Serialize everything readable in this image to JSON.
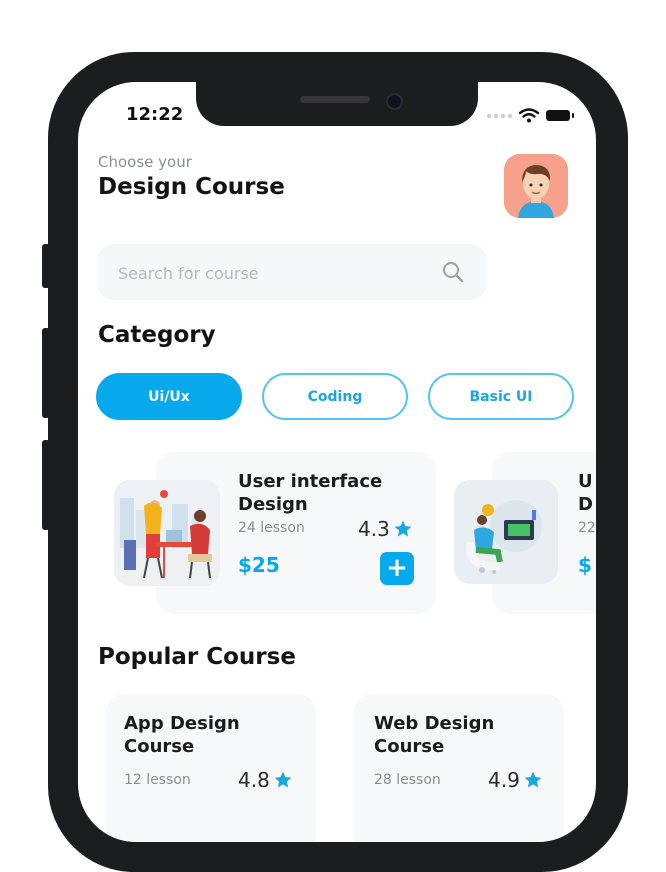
{
  "status_bar": {
    "time": "12:22"
  },
  "header": {
    "subtitle": "Choose your",
    "title": "Design Course"
  },
  "search": {
    "placeholder": "Search for course"
  },
  "category": {
    "heading": "Category",
    "chips": [
      {
        "label": "Ui/Ux",
        "active": true
      },
      {
        "label": "Coding",
        "active": false
      },
      {
        "label": "Basic UI",
        "active": false
      }
    ]
  },
  "courses": [
    {
      "title_line1": "User interface",
      "title_line2": "Design",
      "lessons": "24 lesson",
      "rating": "4.3",
      "price": "$25",
      "add": "+"
    },
    {
      "title_line1": "U",
      "title_line2": "D",
      "lessons": "22",
      "price": "$"
    }
  ],
  "popular": {
    "heading": "Popular Course",
    "items": [
      {
        "title_line1": "App Design",
        "title_line2": "Course",
        "lessons": "12 lesson",
        "rating": "4.8"
      },
      {
        "title_line1": "Web Design",
        "title_line2": "Course",
        "lessons": "28 lesson",
        "rating": "4.9"
      }
    ]
  },
  "colors": {
    "accent": "#08a9ec",
    "star": "#1aa6e0",
    "frame": "#1b1d1f"
  },
  "icons": [
    "search-icon",
    "star-icon",
    "plus-icon",
    "wifi-icon",
    "battery-icon"
  ]
}
